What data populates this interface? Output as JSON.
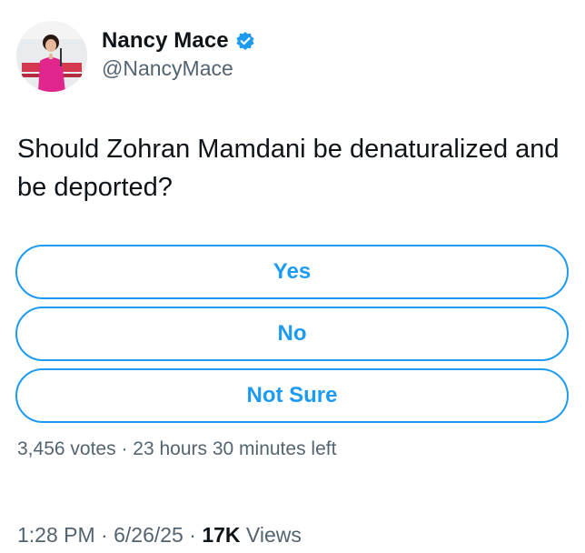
{
  "author": {
    "display_name": "Nancy Mace",
    "handle": "@NancyMace",
    "verified_icon": "verified-badge-icon"
  },
  "tweet": {
    "text": "Should Zohran Mamdani be denaturalized and be deported?"
  },
  "poll": {
    "options": [
      {
        "label": "Yes"
      },
      {
        "label": "No"
      },
      {
        "label": "Not Sure"
      }
    ],
    "votes": "3,456 votes",
    "separator": "·",
    "time_left": "23 hours 30 minutes left"
  },
  "footer": {
    "time": "1:28 PM",
    "date": "6/26/25",
    "separator": "·",
    "views_count": "17K",
    "views_label": "Views"
  },
  "colors": {
    "accent": "#1d9bf0",
    "text_primary": "#0f1419",
    "text_secondary": "#536471"
  }
}
